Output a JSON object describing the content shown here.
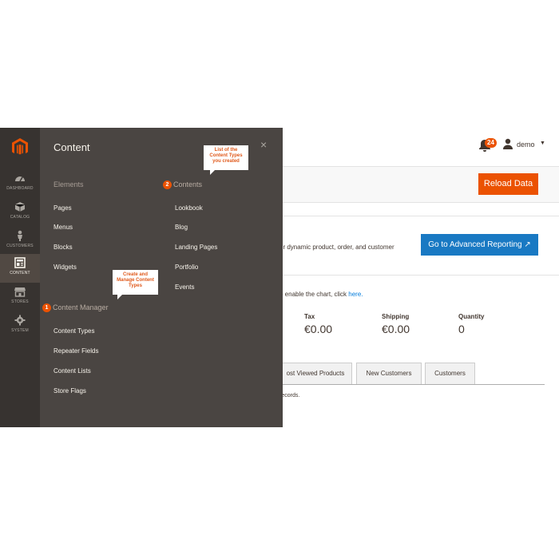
{
  "header": {
    "notifications_count": "24",
    "user_name": "demo",
    "reload_button": "Reload Data"
  },
  "dashboard": {
    "reporting_text": "ur dynamic product, order, and customer",
    "advanced_button": "Go to Advanced Reporting ↗",
    "chart_text_prefix": "o enable the chart, click ",
    "chart_link": "here.",
    "stats": [
      {
        "label": "Tax",
        "value": "€0.00"
      },
      {
        "label": "Shipping",
        "value": "€0.00"
      },
      {
        "label": "Quantity",
        "value": "0"
      }
    ],
    "tabs": [
      "ost Viewed Products",
      "New Customers",
      "Customers"
    ],
    "records_text": "records."
  },
  "sidebar": {
    "items": [
      {
        "label": "DASHBOARD",
        "icon": "dashboard-icon"
      },
      {
        "label": "CATALOG",
        "icon": "catalog-icon"
      },
      {
        "label": "CUSTOMERS",
        "icon": "customers-icon"
      },
      {
        "label": "CONTENT",
        "icon": "content-icon",
        "active": true
      },
      {
        "label": "STORES",
        "icon": "stores-icon"
      },
      {
        "label": "SYSTEM",
        "icon": "system-icon"
      }
    ]
  },
  "flyout": {
    "title": "Content",
    "close_symbol": "×",
    "elements": {
      "title": "Elements",
      "items": [
        "Pages",
        "Menus",
        "Blocks",
        "Widgets"
      ]
    },
    "contents": {
      "marker": "2",
      "title": "Contents",
      "items": [
        "Lookbook",
        "Blog",
        "Landing Pages",
        "Portfolio",
        "Events"
      ]
    },
    "content_manager": {
      "marker": "1",
      "title": "Content Manager",
      "items": [
        "Content Types",
        "Repeater Fields",
        "Content Lists",
        "Store Flags"
      ]
    },
    "callouts": {
      "contents_note": "List of the Content Types you created",
      "manager_note": "Create and Manage Content Types"
    }
  },
  "colors": {
    "accent": "#eb5202",
    "primary_button": "#1979c3",
    "sidebar_bg": "#373330",
    "flyout_bg": "#4a4542"
  }
}
